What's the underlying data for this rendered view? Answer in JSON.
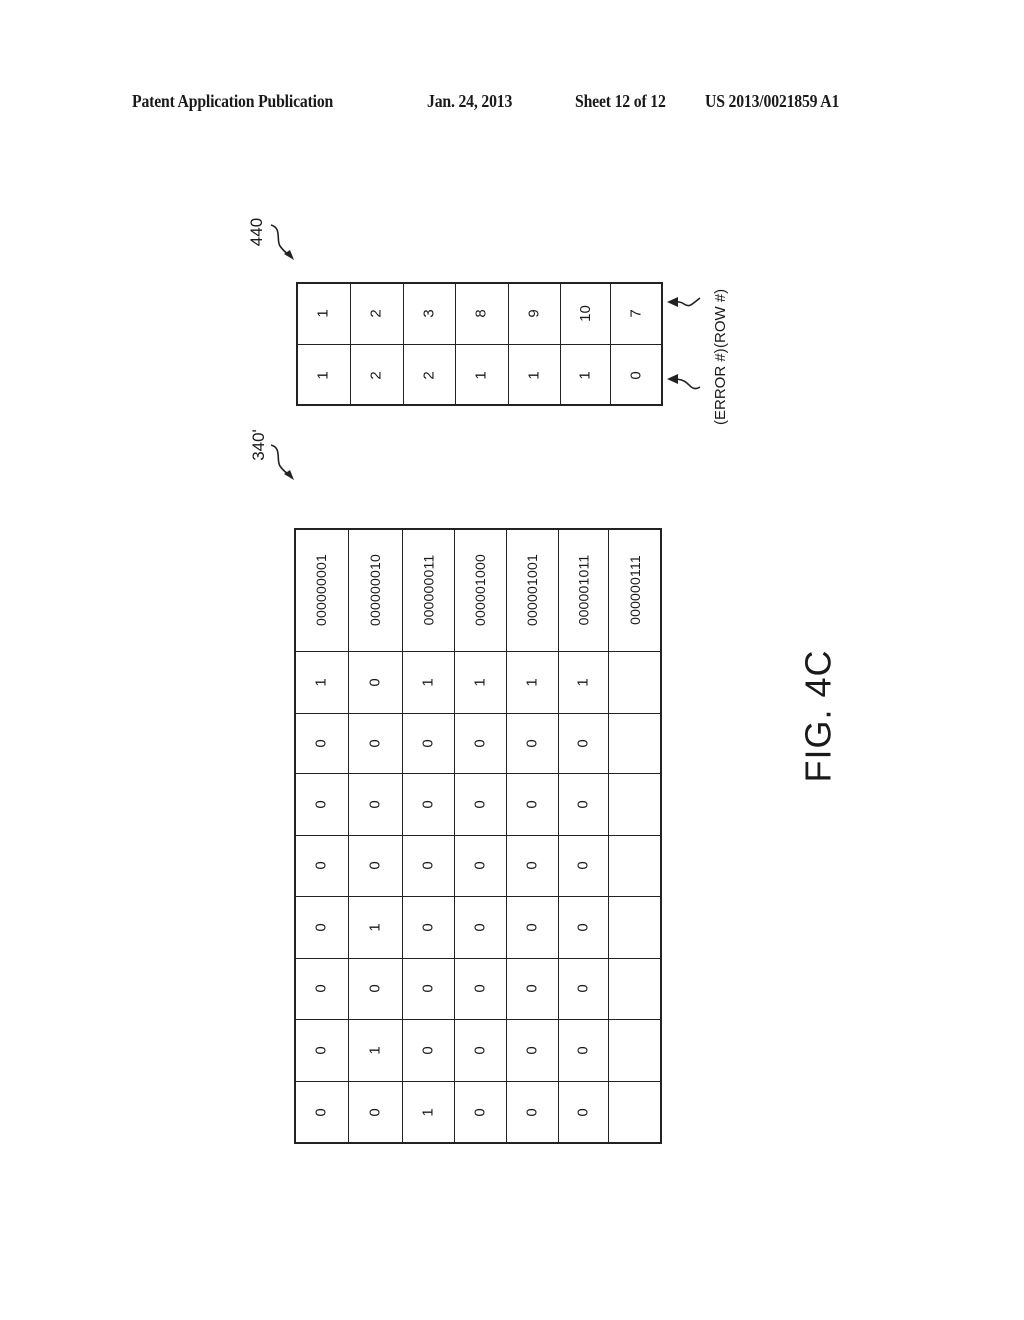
{
  "header": {
    "publication": "Patent Application Publication",
    "date": "Jan. 24, 2013",
    "sheet": "Sheet 12 of 12",
    "number": "US 2013/0021859 A1"
  },
  "figure_label": "FIG. 4C",
  "table_440": {
    "ref": "440",
    "row_label": "(ROW #)",
    "error_label": "(ERROR #)",
    "entries": [
      {
        "row": "1",
        "error": "1"
      },
      {
        "row": "2",
        "error": "2"
      },
      {
        "row": "3",
        "error": "2"
      },
      {
        "row": "8",
        "error": "1"
      },
      {
        "row": "9",
        "error": "1"
      },
      {
        "row": "10",
        "error": "1"
      },
      {
        "row": "7",
        "error": "0"
      }
    ]
  },
  "table_340": {
    "ref": "340'",
    "entries": [
      {
        "code": "000000001",
        "bits": [
          "1",
          "0",
          "0",
          "0",
          "0",
          "0",
          "0",
          "0"
        ]
      },
      {
        "code": "000000010",
        "bits": [
          "0",
          "0",
          "0",
          "0",
          "1",
          "0",
          "1",
          "0"
        ]
      },
      {
        "code": "000000011",
        "bits": [
          "1",
          "0",
          "0",
          "0",
          "0",
          "0",
          "0",
          "1"
        ]
      },
      {
        "code": "000001000",
        "bits": [
          "1",
          "0",
          "0",
          "0",
          "0",
          "0",
          "0",
          "0"
        ]
      },
      {
        "code": "000001001",
        "bits": [
          "1",
          "0",
          "0",
          "0",
          "0",
          "0",
          "0",
          "0"
        ]
      },
      {
        "code": "000001011",
        "bits": [
          "1",
          "0",
          "0",
          "0",
          "0",
          "0",
          "0",
          "0"
        ]
      },
      {
        "code": "000000111",
        "bits": [
          "",
          "",
          "",
          "",
          "",
          "",
          "",
          ""
        ]
      }
    ]
  }
}
